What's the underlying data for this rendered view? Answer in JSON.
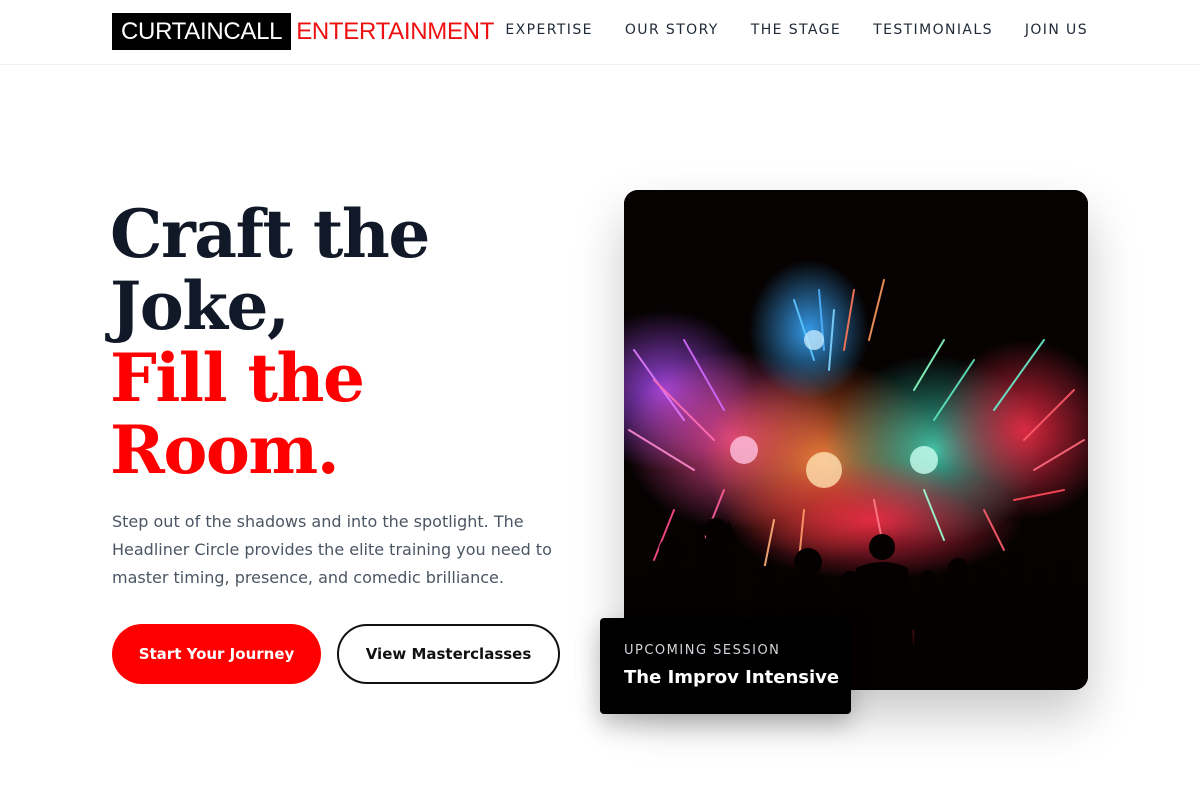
{
  "brand": {
    "name_part1": "CURTAINCALL",
    "name_part2": "ENTERTAINMENT",
    "accent_color": "#ff0000"
  },
  "nav": {
    "items": [
      {
        "label": "EXPERTISE"
      },
      {
        "label": "OUR STORY"
      },
      {
        "label": "THE STAGE"
      },
      {
        "label": "TESTIMONIALS"
      },
      {
        "label": "JOIN US"
      }
    ]
  },
  "hero": {
    "title_line1": "Craft the",
    "title_line2": "Joke,",
    "title_line3": "Fill the",
    "title_line4": "Room.",
    "description": "Step out of the shadows and into the spotlight. The Headliner Circle provides the elite training you need to master timing, presence, and comedic brilliance.",
    "primary_cta": "Start Your Journey",
    "secondary_cta": "View Masterclasses"
  },
  "image": {
    "icon": "fireworks-crowd-photo"
  },
  "session_card": {
    "kicker": "UPCOMING SESSION",
    "title": "The Improv Intensive"
  }
}
